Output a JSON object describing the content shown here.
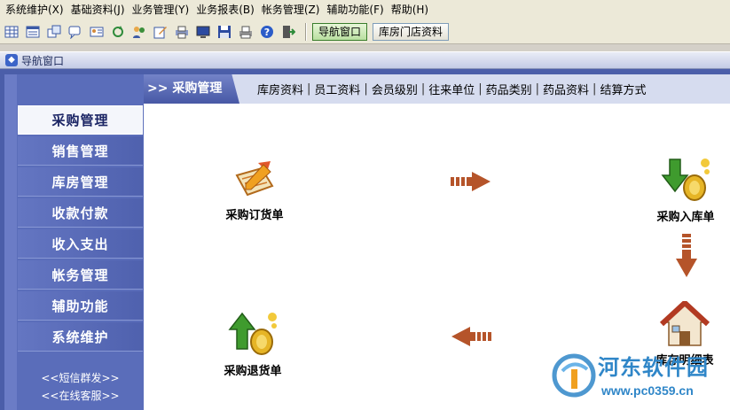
{
  "menubar": {
    "items": [
      "系统维护(X)",
      "基础资料(J)",
      "业务管理(Y)",
      "业务报表(B)",
      "帐务管理(Z)",
      "辅助功能(F)",
      "帮助(H)"
    ]
  },
  "toolbar": {
    "icons": [
      "grid-icon",
      "list-icon",
      "windows-icon",
      "chat-icon",
      "user-card-icon",
      "refresh-icon",
      "users-icon",
      "edit-icon",
      "printer-icon",
      "monitor-icon",
      "save-icon",
      "print-icon",
      "help-icon",
      "exit-icon"
    ],
    "nav_button": "导航窗口",
    "store_button": "库房门店资料"
  },
  "window": {
    "title": "导航窗口"
  },
  "sidebar": {
    "items": [
      "采购管理",
      "销售管理",
      "库房管理",
      "收款付款",
      "收入支出",
      "帐务管理",
      "辅助功能",
      "系统维护"
    ],
    "active_index": 0,
    "links": [
      "<<短信群发>>",
      "<<在线客服>>"
    ]
  },
  "content": {
    "tab_title": ">> 采购管理",
    "tab_links": [
      "库房资料",
      "员工资料",
      "会员级别",
      "往来单位",
      "药品类别",
      "药品资料",
      "结算方式"
    ],
    "nodes": {
      "order": "采购订货单",
      "stock_in": "采购入库单",
      "return": "采购退货单",
      "inventory": "库存明细表"
    }
  },
  "watermark": {
    "title": "河东软件园",
    "url": "www.pc0359.cn"
  },
  "colors": {
    "frame": "#4b5ea9",
    "sidebar": "#5a6dba",
    "arrow": "#b5542a",
    "watermark": "#2f86c8"
  }
}
